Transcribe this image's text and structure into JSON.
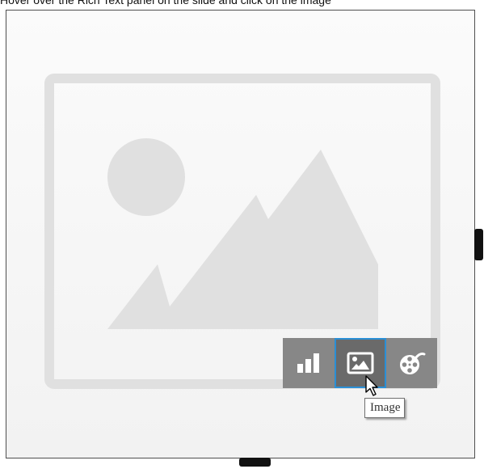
{
  "instruction": {
    "text": "Hover over the Rich Text panel on the slide and click on the image"
  },
  "slide": {
    "placeholder_icon": "image-placeholder-icon"
  },
  "media_toolbar": {
    "buttons": [
      {
        "icon": "bar-chart-icon",
        "label": "Chart",
        "active": false
      },
      {
        "icon": "image-icon",
        "label": "Image",
        "active": true
      },
      {
        "icon": "video-reel-icon",
        "label": "Video",
        "active": false
      }
    ]
  },
  "tooltip": {
    "text": "Image"
  },
  "colors": {
    "toolbar_bg": "#878787",
    "active_bg": "#6a6a6a",
    "active_border": "#2a8fd6",
    "placeholder_fill": "#e0e0e0",
    "panel_border": "#4f4f4f"
  }
}
